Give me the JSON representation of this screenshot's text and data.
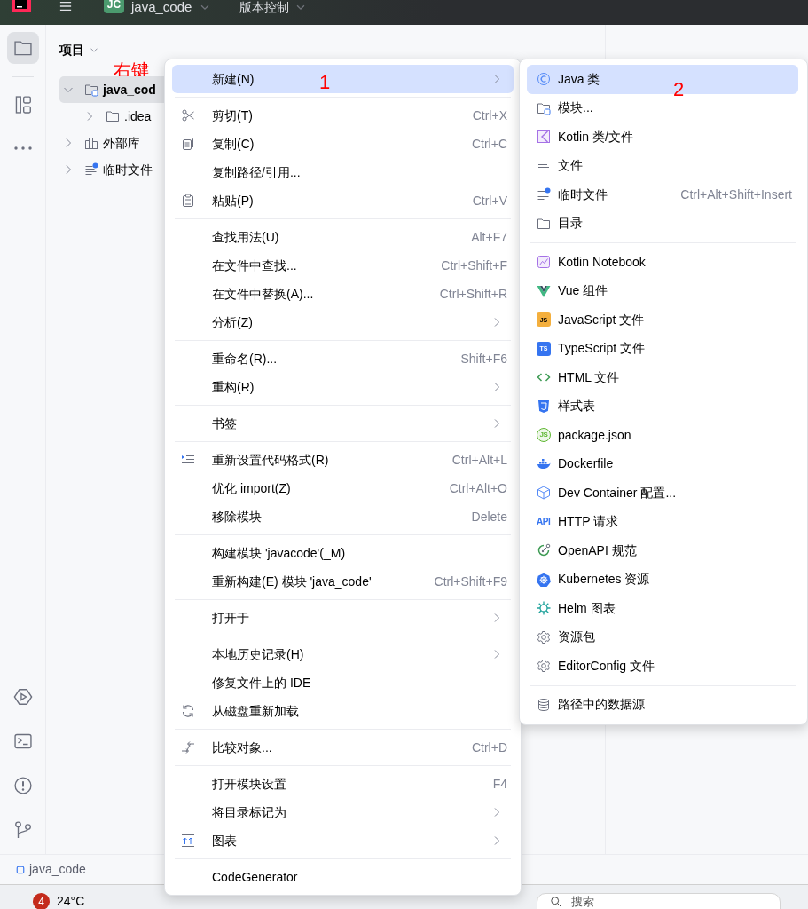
{
  "top_bar": {
    "project_badge": "JC",
    "project_name": "java_code",
    "vcs_menu": "版本控制"
  },
  "tool_strip": {
    "top": [
      {
        "selected": true
      },
      {
        "selected": false
      },
      {
        "selected": false
      }
    ],
    "bottom": [
      {
        "selected": false
      },
      {
        "selected": false
      },
      {
        "selected": false
      },
      {
        "selected": false
      }
    ]
  },
  "project_panel": {
    "title": "项目",
    "tree": [
      {
        "label": "java_cod",
        "expanded": true,
        "selected": true,
        "annotation": "右键",
        "children": [
          {
            "label": ".idea",
            "expanded": false,
            "selected": false
          }
        ]
      },
      {
        "label": "外部库",
        "expanded": false,
        "selected": false
      },
      {
        "label": "临时文件",
        "expanded": false,
        "selected": false
      }
    ]
  },
  "context_menu": {
    "groups": [
      [
        {
          "label": "新建(N)",
          "submenu": true,
          "selected": true,
          "annotation": "1"
        }
      ],
      [
        {
          "label": "剪切(T)",
          "shortcut": "Ctrl+X",
          "submenu": false,
          "selected": false
        },
        {
          "label": "复制(C)",
          "shortcut": "Ctrl+C",
          "submenu": false,
          "selected": false
        },
        {
          "label": "复制路径/引用...",
          "submenu": false,
          "selected": false
        },
        {
          "label": "粘贴(P)",
          "shortcut": "Ctrl+V",
          "submenu": false,
          "selected": false
        }
      ],
      [
        {
          "label": "查找用法(U)",
          "shortcut": "Alt+F7",
          "submenu": false,
          "selected": false
        },
        {
          "label": "在文件中查找...",
          "shortcut": "Ctrl+Shift+F",
          "submenu": false,
          "selected": false
        },
        {
          "label": "在文件中替换(A)...",
          "shortcut": "Ctrl+Shift+R",
          "submenu": false,
          "selected": false
        },
        {
          "label": "分析(Z)",
          "submenu": true,
          "selected": false
        }
      ],
      [
        {
          "label": "重命名(R)...",
          "shortcut": "Shift+F6",
          "submenu": false,
          "selected": false
        },
        {
          "label": "重构(R)",
          "submenu": true,
          "selected": false
        }
      ],
      [
        {
          "label": "书签",
          "submenu": true,
          "selected": false
        }
      ],
      [
        {
          "label": "重新设置代码格式(R)",
          "shortcut": "Ctrl+Alt+L",
          "submenu": false,
          "selected": false
        },
        {
          "label": "优化 import(Z)",
          "shortcut": "Ctrl+Alt+O",
          "submenu": false,
          "selected": false
        },
        {
          "label": "移除模块",
          "shortcut": "Delete",
          "submenu": false,
          "selected": false
        }
      ],
      [
        {
          "label": "构建模块 'javacode'(_M)",
          "submenu": false,
          "selected": false
        },
        {
          "label": "重新构建(E) 模块 'java_code'",
          "shortcut": "Ctrl+Shift+F9",
          "submenu": false,
          "selected": false
        }
      ],
      [
        {
          "label": "打开于",
          "submenu": true,
          "selected": false
        }
      ],
      [
        {
          "label": "本地历史记录(H)",
          "submenu": true,
          "selected": false
        },
        {
          "label": "修复文件上的 IDE",
          "submenu": false,
          "selected": false
        },
        {
          "label": "从磁盘重新加载",
          "submenu": false,
          "selected": false
        }
      ],
      [
        {
          "label": "比较对象...",
          "shortcut": "Ctrl+D",
          "submenu": false,
          "selected": false
        }
      ],
      [
        {
          "label": "打开模块设置",
          "shortcut": "F4",
          "submenu": false,
          "selected": false
        },
        {
          "label": "将目录标记为",
          "submenu": true,
          "selected": false
        },
        {
          "label": "图表",
          "submenu": true,
          "selected": false
        }
      ],
      [
        {
          "label": "CodeGenerator",
          "submenu": false,
          "selected": false
        }
      ]
    ]
  },
  "new_submenu": {
    "groups": [
      [
        {
          "label": "Java 类",
          "selected": true,
          "annotation": "2"
        },
        {
          "label": "模块...",
          "selected": false
        },
        {
          "label": "Kotlin 类/文件",
          "selected": false
        },
        {
          "label": "文件",
          "selected": false
        },
        {
          "label": "临时文件",
          "shortcut": "Ctrl+Alt+Shift+Insert",
          "selected": false
        },
        {
          "label": "目录",
          "selected": false
        }
      ],
      [
        {
          "label": "Kotlin Notebook",
          "selected": false
        },
        {
          "label": "Vue 组件",
          "selected": false
        },
        {
          "label": "JavaScript 文件",
          "icon_text": "JS",
          "selected": false
        },
        {
          "label": "TypeScript 文件",
          "icon_text": "TS",
          "selected": false
        },
        {
          "label": "HTML 文件",
          "selected": false
        },
        {
          "label": "样式表",
          "selected": false
        },
        {
          "label": "package.json",
          "icon_text": "JS",
          "selected": false
        },
        {
          "label": "Dockerfile",
          "selected": false
        },
        {
          "label": "Dev Container 配置...",
          "selected": false
        },
        {
          "label": "HTTP 请求",
          "icon_text": "API",
          "selected": false
        },
        {
          "label": "OpenAPI 规范",
          "selected": false
        },
        {
          "label": "Kubernetes 资源",
          "selected": false
        },
        {
          "label": "Helm 图表",
          "selected": false
        },
        {
          "label": "资源包",
          "selected": false
        },
        {
          "label": "EditorConfig 文件",
          "selected": false
        }
      ],
      [
        {
          "label": "路径中的数据源",
          "selected": false
        }
      ]
    ]
  },
  "status_bar": {
    "breadcrumb": "java_code"
  },
  "taskbar": {
    "notification_count": "4",
    "weather": "24°C",
    "search": {
      "placeholder": "搜索"
    }
  }
}
